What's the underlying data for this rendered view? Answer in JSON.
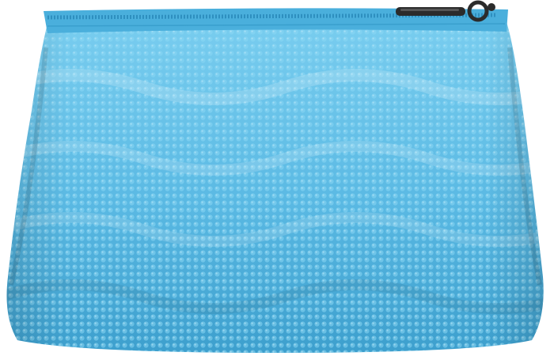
{
  "subject": "pouch",
  "colors": {
    "background": "#ffffff",
    "body_light": "#79cdef",
    "body_mid": "#5ab9e3",
    "body_dark": "#3d9fcd",
    "zipper_tape": "#4aafdc",
    "zipper_teeth": "#2e8fbf",
    "puller": "#2b2b2b",
    "puller_highlight": "#6a6a6a"
  }
}
